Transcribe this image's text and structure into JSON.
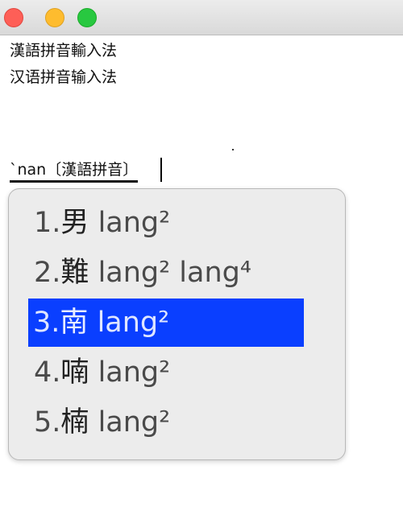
{
  "window": {
    "close_label": "",
    "minimize_label": "",
    "maximize_label": ""
  },
  "document": {
    "line1": "漢語拼音輸入法",
    "line2": "汉语拼音输入法"
  },
  "input": {
    "composition": "`nan〔漢語拼音〕"
  },
  "candidates": [
    {
      "number": "1.",
      "hanzi": "男",
      "reading": "lang²"
    },
    {
      "number": "2.",
      "hanzi": "難",
      "reading": "lang² lang⁴"
    },
    {
      "number": "3.",
      "hanzi": "南",
      "reading": "lang²"
    },
    {
      "number": "4.",
      "hanzi": "喃",
      "reading": "lang²"
    },
    {
      "number": "5.",
      "hanzi": "楠",
      "reading": "lang²"
    }
  ],
  "selected_candidate": "3.",
  "colors": {
    "selection": "#0a3fff",
    "close": "#fe5f57",
    "minimize": "#febc2e",
    "maximize": "#28c840"
  }
}
